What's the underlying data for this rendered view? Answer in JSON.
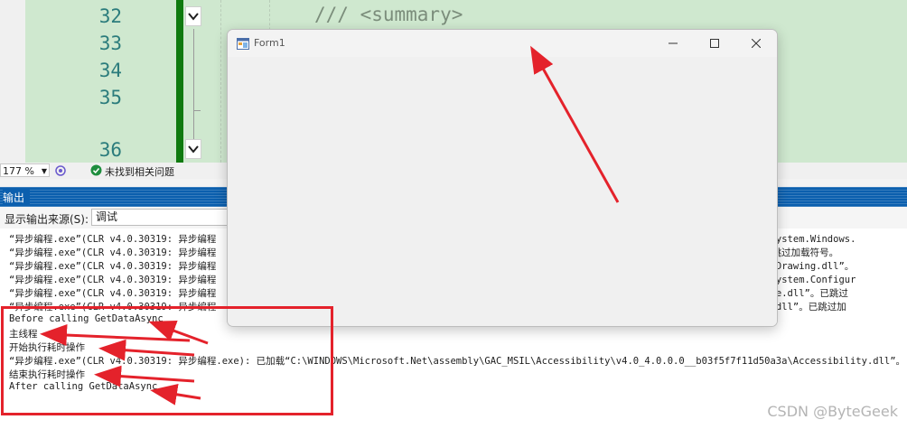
{
  "editor": {
    "line_numbers": [
      "32",
      "33",
      "34",
      "35",
      "36"
    ],
    "code_line": "/// <summary>"
  },
  "statusbar": {
    "zoom": "177 %",
    "issues": "未找到相关问题"
  },
  "output": {
    "title": "输出",
    "source_label": "显示输出来源(S):",
    "source_value": "调试",
    "lines": [
      "“异步编程.exe”(CLR v4.0.30319: 异步编程                                                                                       61934e089\\System.Windows.",
      "“异步编程.exe”(CLR v4.0.30319: 异步编程                                                                                       em.dll”。已跳过加载符号。",
      "“异步编程.exe”(CLR v4.0.30319: 异步编程                                                                                       a3a\\System.Drawing.dll”。",
      "“异步编程.exe”(CLR v4.0.30319: 异步编程                                                                                       f11d50a3a\\System.Configur",
      "“异步编程.exe”(CLR v4.0.30319: 异步编程                                                                                       \\System.Core.dll”。已跳过",
      "“异步编程.exe”(CLR v4.0.30319: 异步编程                                                                                       System.Xml.dll”。已跳过加",
      "Before calling GetDataAsync",
      "主线程",
      "开始执行耗时操作",
      "“异步编程.exe”(CLR v4.0.30319: 异步编程.exe): 已加载“C:\\WINDOWS\\Microsoft.Net\\assembly\\GAC_MSIL\\Accessibility\\v4.0_4.0.0.0__b03f5f7f11d50a3a\\Accessibility.dll”。",
      "结束执行耗时操作",
      "After calling GetDataAsync"
    ]
  },
  "form1": {
    "title": "Form1"
  },
  "watermark": "CSDN @ByteGeek",
  "colors": {
    "annotation_red": "#e4222b",
    "output_header_blue": "#0b5fae",
    "editor_green": "#cfe8cf"
  }
}
